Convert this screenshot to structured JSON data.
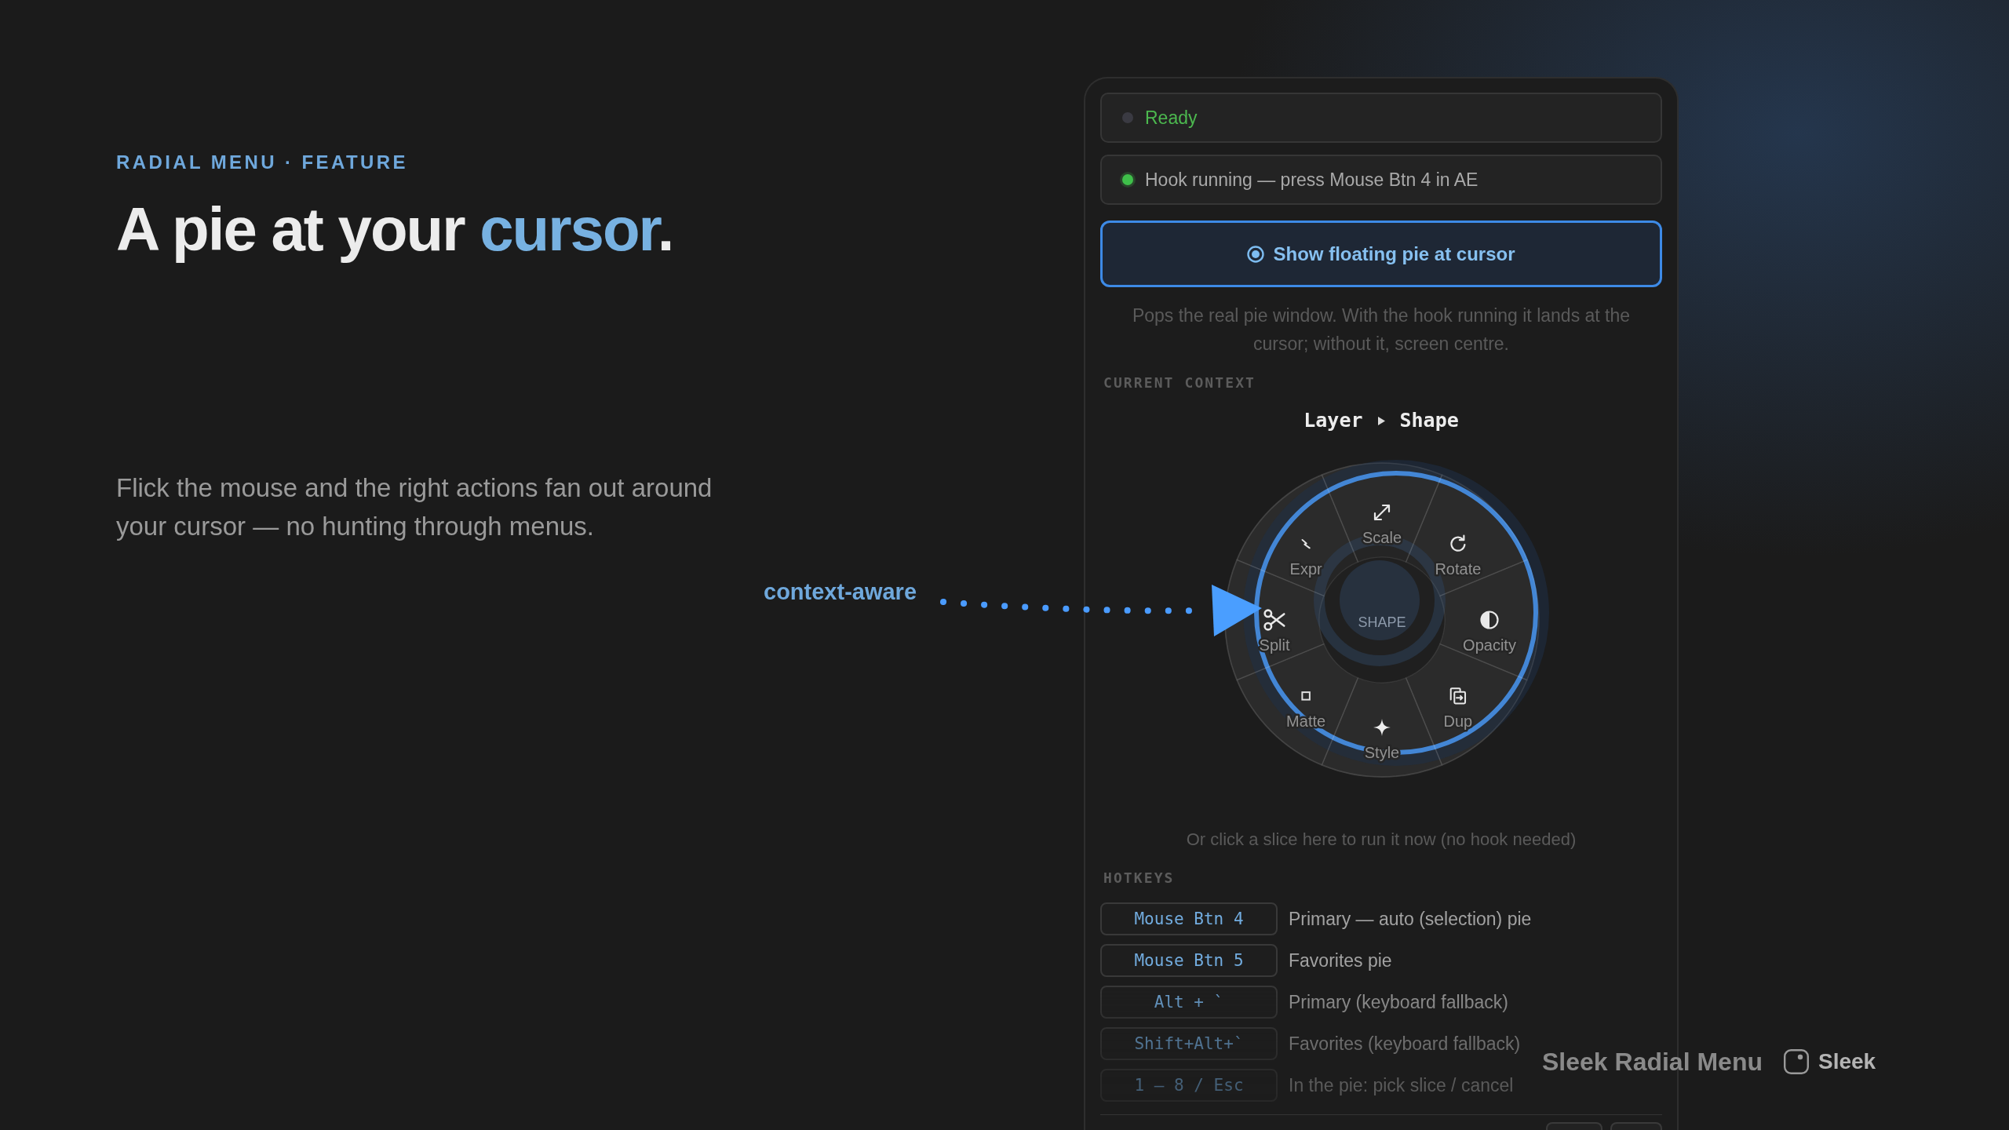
{
  "hero": {
    "eyebrow": "RADIAL MENU · FEATURE",
    "headline": [
      {
        "text": "A pie at your ",
        "accent": false
      },
      {
        "text": "cursor",
        "accent": true
      },
      {
        "text": ".",
        "accent": false
      }
    ],
    "body": "Flick the mouse and the right actions fan out around your cursor — no hunting through menus."
  },
  "callout": {
    "label": "context-aware"
  },
  "panel": {
    "status_rows": [
      {
        "kind": "status",
        "text": "Ready",
        "on": false
      },
      {
        "kind": "hook",
        "text": "Hook running — press Mouse Btn 4 in AE",
        "on": true
      }
    ],
    "primary_button": {
      "label": "Show floating pie at cursor"
    },
    "button_hint": "Pops the real pie window. With the hook running it lands at the cursor; without it, screen centre.",
    "context": {
      "heading": "CURRENT CONTEXT",
      "path": [
        "Layer",
        "Shape"
      ]
    },
    "pie": {
      "center_label": "SHAPE",
      "slices": [
        {
          "label": "Scale"
        },
        {
          "label": "Rotate"
        },
        {
          "label": "Opacity"
        },
        {
          "label": "Dup"
        },
        {
          "label": "Style"
        },
        {
          "label": "Matte"
        },
        {
          "label": "Split"
        },
        {
          "label": "Expr"
        }
      ]
    },
    "pie_hint": "Or click a slice here to run it now (no hook needed)",
    "hotkeys": {
      "heading": "HOTKEYS",
      "rows": [
        {
          "key": "Mouse Btn 4",
          "description": "Primary — auto (selection) pie"
        },
        {
          "key": "Mouse Btn 5",
          "description": "Favorites pie"
        },
        {
          "key": "Alt + `",
          "description": "Primary (keyboard fallback)"
        },
        {
          "key": "Shift+Alt+`",
          "description": "Favorites (keyboard fallback)"
        },
        {
          "key": "1 – 8 / Esc",
          "description": "In the pie: pick slice / cancel"
        }
      ]
    }
  },
  "brand": {
    "title": "Sleek Radial Menu",
    "name": "Sleek"
  }
}
